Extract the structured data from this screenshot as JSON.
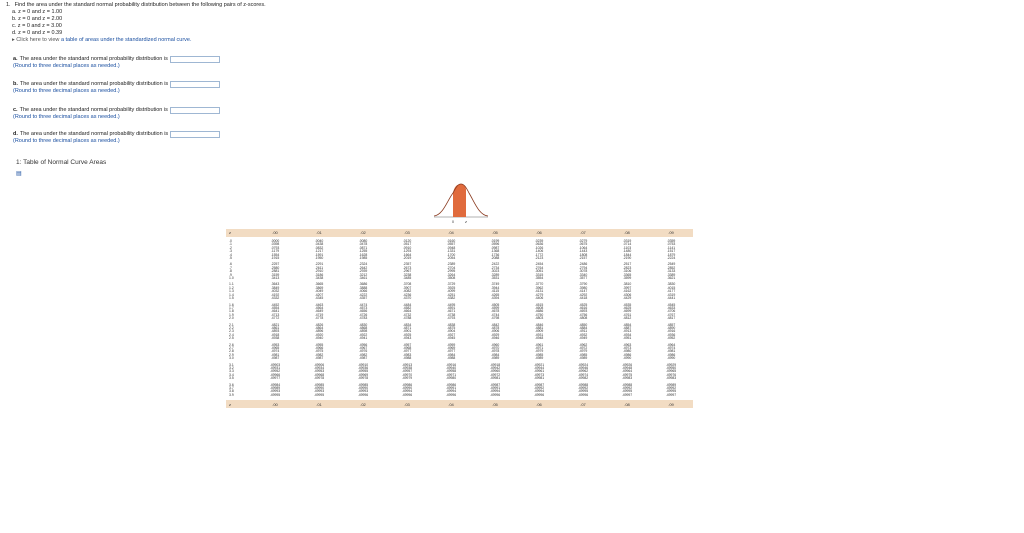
{
  "question": {
    "number": "1.",
    "prompt": "Find the area under the standard normal probability distribution between the following pairs of z-scores.",
    "items": [
      "a. z = 0 and z = 1.00",
      "b. z = 0 and z = 2.00",
      "c. z = 0 and z = 3.00",
      "d. z = 0 and z = 0.39"
    ],
    "note_prefix": "Click here to view",
    "note_link": "a table of areas under the standardized normal curve."
  },
  "parts": [
    {
      "label": "a.",
      "text": "The area under the standard normal probability distribution is",
      "value": "",
      "hint": "(Round to three decimal places as needed.)"
    },
    {
      "label": "b.",
      "text": "The area under the standard normal probability distribution is",
      "value": "",
      "hint": "(Round to three decimal places as needed.)"
    },
    {
      "label": "c.",
      "text": "The area under the standard normal probability distribution is",
      "value": "",
      "hint": "(Round to three decimal places as needed.)"
    },
    {
      "label": "d.",
      "text": "The area under the standard normal probability distribution is",
      "value": "",
      "hint": "(Round to three decimal places as needed.)"
    }
  ],
  "table": {
    "title": "1: Table of Normal Curve Areas",
    "curve_labels": {
      "left": "0",
      "right": "z"
    },
    "colors": {
      "header_bg": "#f2dcc3",
      "curve_fill": "#e06b3d",
      "curve_line": "#8a3a1f"
    },
    "columns": [
      "z",
      ".00",
      ".01",
      ".02",
      ".03",
      ".04",
      ".05",
      ".06",
      ".07",
      ".08",
      ".09"
    ],
    "groups": [
      [
        [
          ".0",
          ".0000",
          ".0040",
          ".0080",
          ".0120",
          ".0160",
          ".0199",
          ".0239",
          ".0279",
          ".0319",
          ".0359"
        ],
        [
          ".1",
          ".0398",
          ".0438",
          ".0478",
          ".0517",
          ".0557",
          ".0596",
          ".0636",
          ".0675",
          ".0714",
          ".0753"
        ],
        [
          ".2",
          ".0793",
          ".0832",
          ".0871",
          ".0910",
          ".0948",
          ".0987",
          ".1026",
          ".1064",
          ".1103",
          ".1141"
        ],
        [
          ".3",
          ".1179",
          ".1217",
          ".1255",
          ".1293",
          ".1331",
          ".1368",
          ".1406",
          ".1443",
          ".1480",
          ".1517"
        ],
        [
          ".4",
          ".1554",
          ".1591",
          ".1628",
          ".1664",
          ".1700",
          ".1736",
          ".1772",
          ".1808",
          ".1844",
          ".1879"
        ],
        [
          ".5",
          ".1915",
          ".1950",
          ".1985",
          ".2019",
          ".2054",
          ".2088",
          ".2123",
          ".2157",
          ".2190",
          ".2224"
        ]
      ],
      [
        [
          ".6",
          ".2257",
          ".2291",
          ".2324",
          ".2357",
          ".2389",
          ".2422",
          ".2454",
          ".2486",
          ".2517",
          ".2549"
        ],
        [
          ".7",
          ".2580",
          ".2611",
          ".2642",
          ".2673",
          ".2704",
          ".2734",
          ".2764",
          ".2794",
          ".2823",
          ".2852"
        ],
        [
          ".8",
          ".2881",
          ".2910",
          ".2939",
          ".2967",
          ".2995",
          ".3023",
          ".3051",
          ".3078",
          ".3106",
          ".3133"
        ],
        [
          ".9",
          ".3159",
          ".3186",
          ".3212",
          ".3238",
          ".3264",
          ".3289",
          ".3315",
          ".3340",
          ".3365",
          ".3389"
        ],
        [
          "1.0",
          ".3413",
          ".3438",
          ".3461",
          ".3485",
          ".3508",
          ".3531",
          ".3554",
          ".3577",
          ".3599",
          ".3621"
        ]
      ],
      [
        [
          "1.1",
          ".3643",
          ".3665",
          ".3686",
          ".3708",
          ".3729",
          ".3749",
          ".3770",
          ".3790",
          ".3810",
          ".3830"
        ],
        [
          "1.2",
          ".3849",
          ".3869",
          ".3888",
          ".3907",
          ".3925",
          ".3944",
          ".3962",
          ".3980",
          ".3997",
          ".4015"
        ],
        [
          "1.3",
          ".4032",
          ".4049",
          ".4066",
          ".4082",
          ".4099",
          ".4115",
          ".4131",
          ".4147",
          ".4162",
          ".4177"
        ],
        [
          "1.4",
          ".4192",
          ".4207",
          ".4222",
          ".4236",
          ".4251",
          ".4265",
          ".4279",
          ".4292",
          ".4306",
          ".4319"
        ],
        [
          "1.5",
          ".4332",
          ".4345",
          ".4357",
          ".4370",
          ".4382",
          ".4394",
          ".4406",
          ".4418",
          ".4429",
          ".4441"
        ]
      ],
      [
        [
          "1.6",
          ".4452",
          ".4463",
          ".4474",
          ".4484",
          ".4495",
          ".4505",
          ".4515",
          ".4525",
          ".4535",
          ".4545"
        ],
        [
          "1.7",
          ".4554",
          ".4564",
          ".4573",
          ".4582",
          ".4591",
          ".4599",
          ".4608",
          ".4616",
          ".4625",
          ".4633"
        ],
        [
          "1.8",
          ".4641",
          ".4649",
          ".4656",
          ".4664",
          ".4671",
          ".4678",
          ".4686",
          ".4693",
          ".4699",
          ".4706"
        ],
        [
          "1.9",
          ".4713",
          ".4719",
          ".4726",
          ".4732",
          ".4738",
          ".4744",
          ".4750",
          ".4756",
          ".4761",
          ".4767"
        ],
        [
          "2.0",
          ".4772",
          ".4778",
          ".4783",
          ".4788",
          ".4793",
          ".4798",
          ".4803",
          ".4808",
          ".4812",
          ".4817"
        ]
      ],
      [
        [
          "2.1",
          ".4821",
          ".4826",
          ".4830",
          ".4834",
          ".4838",
          ".4842",
          ".4846",
          ".4850",
          ".4854",
          ".4857"
        ],
        [
          "2.2",
          ".4861",
          ".4864",
          ".4868",
          ".4871",
          ".4875",
          ".4878",
          ".4881",
          ".4884",
          ".4887",
          ".4890"
        ],
        [
          "2.3",
          ".4893",
          ".4896",
          ".4898",
          ".4901",
          ".4904",
          ".4906",
          ".4909",
          ".4911",
          ".4913",
          ".4916"
        ],
        [
          "2.4",
          ".4918",
          ".4920",
          ".4922",
          ".4925",
          ".4927",
          ".4929",
          ".4931",
          ".4932",
          ".4934",
          ".4936"
        ],
        [
          "2.5",
          ".4938",
          ".4940",
          ".4941",
          ".4943",
          ".4945",
          ".4946",
          ".4948",
          ".4949",
          ".4951",
          ".4952"
        ]
      ],
      [
        [
          "2.6",
          ".4953",
          ".4955",
          ".4956",
          ".4957",
          ".4959",
          ".4960",
          ".4961",
          ".4962",
          ".4963",
          ".4964"
        ],
        [
          "2.7",
          ".4965",
          ".4966",
          ".4967",
          ".4968",
          ".4969",
          ".4970",
          ".4971",
          ".4972",
          ".4973",
          ".4974"
        ],
        [
          "2.8",
          ".4974",
          ".4975",
          ".4976",
          ".4977",
          ".4977",
          ".4978",
          ".4979",
          ".4979",
          ".4980",
          ".4981"
        ],
        [
          "2.9",
          ".4981",
          ".4982",
          ".4982",
          ".4983",
          ".4984",
          ".4984",
          ".4985",
          ".4985",
          ".4986",
          ".4986"
        ],
        [
          "3.0",
          ".4987",
          ".4987",
          ".4987",
          ".4988",
          ".4988",
          ".4989",
          ".4989",
          ".4989",
          ".4990",
          ".4990"
        ]
      ],
      [
        [
          "3.1",
          ".49903",
          ".49906",
          ".49910",
          ".49913",
          ".49916",
          ".49918",
          ".49921",
          ".49924",
          ".49926",
          ".49929"
        ],
        [
          "3.2",
          ".49931",
          ".49934",
          ".49936",
          ".49938",
          ".49940",
          ".49942",
          ".49944",
          ".49946",
          ".49948",
          ".49950"
        ],
        [
          "3.3",
          ".49952",
          ".49953",
          ".49955",
          ".49957",
          ".49958",
          ".49960",
          ".49961",
          ".49962",
          ".49964",
          ".49965"
        ],
        [
          "3.4",
          ".49966",
          ".49968",
          ".49969",
          ".49970",
          ".49971",
          ".49972",
          ".49973",
          ".49974",
          ".49975",
          ".49976"
        ],
        [
          "3.5",
          ".49977",
          ".49978",
          ".49978",
          ".49979",
          ".49980",
          ".49981",
          ".49981",
          ".49982",
          ".49983",
          ".49983"
        ]
      ],
      [
        [
          "3.6",
          ".49984",
          ".49985",
          ".49985",
          ".49986",
          ".49986",
          ".49987",
          ".49987",
          ".49988",
          ".49988",
          ".49989"
        ],
        [
          "3.7",
          ".49989",
          ".49990",
          ".49990",
          ".49990",
          ".49991",
          ".49991",
          ".49992",
          ".49992",
          ".49992",
          ".49992"
        ],
        [
          "3.8",
          ".49993",
          ".49993",
          ".49993",
          ".49994",
          ".49994",
          ".49994",
          ".49994",
          ".49995",
          ".49995",
          ".49995"
        ],
        [
          "3.9",
          ".49995",
          ".49995",
          ".49996",
          ".49996",
          ".49996",
          ".49996",
          ".49996",
          ".49996",
          ".49997",
          ".49997"
        ]
      ]
    ]
  }
}
